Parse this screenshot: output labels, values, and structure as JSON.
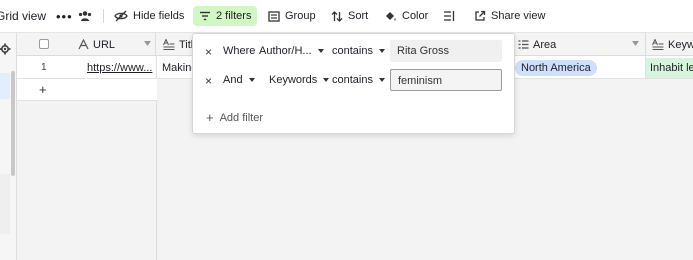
{
  "toolbar": {
    "view_name": "Grid view",
    "more_label": "•••",
    "hide_fields": "Hide fields",
    "filters": "2 filters",
    "group": "Group",
    "sort": "Sort",
    "color": "Color",
    "share_view": "Share view",
    "filters_active_color": "#d1f7c4"
  },
  "grid": {
    "columns": [
      {
        "name": "URL",
        "icon": "text-a-icon"
      },
      {
        "name": "Title",
        "display": "Titl",
        "icon": "long-text-icon"
      },
      {
        "name": "Area",
        "icon": "multi-select-icon"
      },
      {
        "name": "Keywords",
        "display": "Keyw",
        "icon": "long-text-icon"
      }
    ],
    "rows": [
      {
        "number": "1",
        "url": "https://www...",
        "title": "Making",
        "area": "North America",
        "keywords": "Inhabit le"
      }
    ],
    "add_row_label": "+"
  },
  "filter_popup": {
    "conditions": [
      {
        "conjunction": "Where",
        "field": "Author/H...",
        "operator": "contains",
        "value": "Rita Gross"
      },
      {
        "conjunction": "And",
        "field": "Keywords",
        "operator": "contains",
        "value": "feminism"
      }
    ],
    "remove_label": "×",
    "add_filter_label": "Add filter"
  },
  "colors": {
    "area_pill": "#cfe0fc",
    "keyword_chip": "#d7f5dc"
  }
}
